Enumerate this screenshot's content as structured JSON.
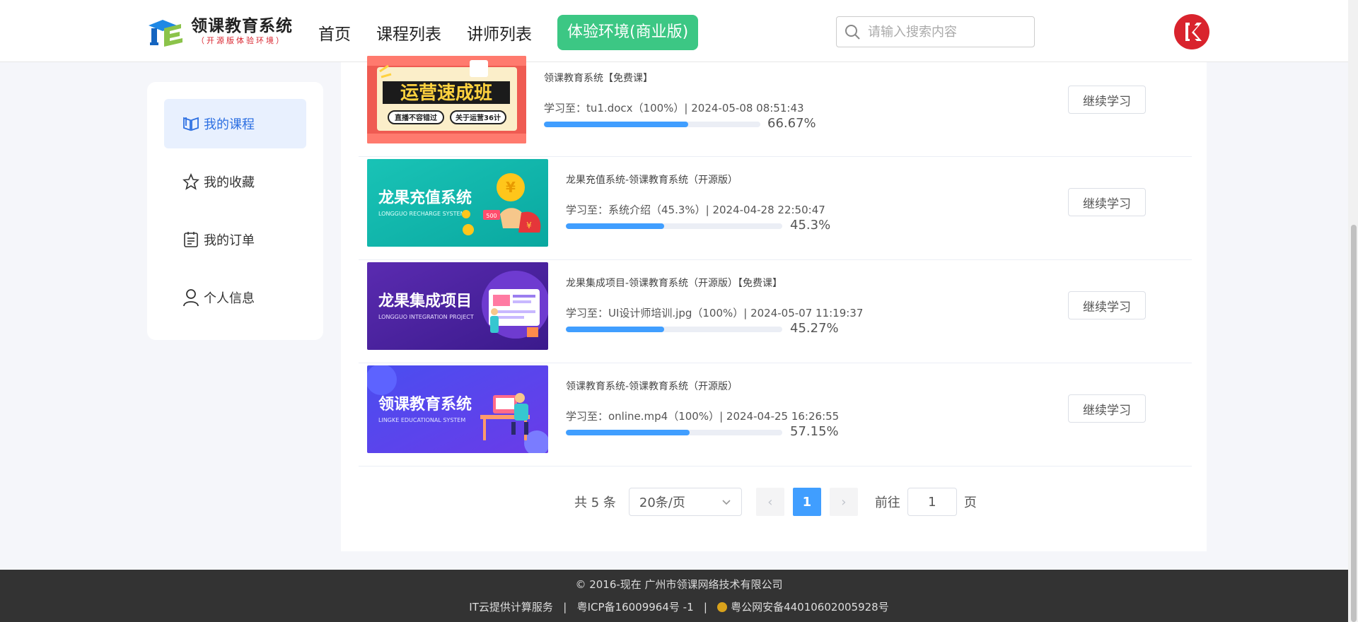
{
  "header": {
    "logo_title": "领课教育系统",
    "logo_sub": "（开源版体验环境）",
    "nav": [
      "首页",
      "课程列表",
      "讲师列表"
    ],
    "cta": "体验环境(商业版)",
    "search_placeholder": "请输入搜索内容",
    "brand_color": "#3cc784"
  },
  "sidebar": {
    "items": [
      {
        "label": "我的课程",
        "icon": "book-icon",
        "active": true
      },
      {
        "label": "我的收藏",
        "icon": "star-icon",
        "active": false
      },
      {
        "label": "我的订单",
        "icon": "order-list-icon",
        "active": false
      },
      {
        "label": "个人信息",
        "icon": "user-icon",
        "active": false
      }
    ]
  },
  "courses": [
    {
      "title": "领课教育系统【免费课】",
      "progress_text": "学习至：tu1.docx（100%）| 2024-05-08 08:51:43",
      "percent_label": "66.67%",
      "percent": 66.67,
      "thumb_title": "运营速成班",
      "thumb_tag1": "直播不容错过",
      "thumb_tag2": "关于运营36计",
      "button": "继续学习"
    },
    {
      "title": "龙果充值系统-领课教育系统（开源版）",
      "progress_text": "学习至：系统介绍（45.3%）| 2024-04-28 22:50:47",
      "percent_label": "45.3%",
      "percent": 45.3,
      "thumb_title": "龙果充值系统",
      "thumb_sub": "LONGGUO RECHARGE SYSTEM",
      "button": "继续学习"
    },
    {
      "title": "龙果集成项目-领课教育系统（开源版）【免费课】",
      "progress_text": "学习至：UI设计师培训.jpg（100%）| 2024-05-07 11:19:37",
      "percent_label": "45.27%",
      "percent": 45.27,
      "thumb_title": "龙果集成项目",
      "thumb_sub": "LONGGUO INTEGRATION PROJECT",
      "button": "继续学习"
    },
    {
      "title": "领课教育系统-领课教育系统（开源版）",
      "progress_text": "学习至：online.mp4（100%）| 2024-04-25 16:26:55",
      "percent_label": "57.15%",
      "percent": 57.15,
      "thumb_title": "领课教育系统",
      "thumb_sub": "LINGKE EDUCATIONAL SYSTEM",
      "button": "继续学习"
    }
  ],
  "pagination": {
    "total": "共 5 条",
    "page_size": "20条/页",
    "prev": "‹",
    "current": "1",
    "next": "›",
    "goto_label": "前往",
    "goto_value": "1",
    "goto_suffix": "页"
  },
  "footer": {
    "line1": "© 2016-现在 广州市领课网络技术有限公司",
    "line2_a": "IT云提供计算服务",
    "line2_b": "粤ICP备16009964号 -1",
    "line2_c": "粤公网安备44010602005928号"
  }
}
